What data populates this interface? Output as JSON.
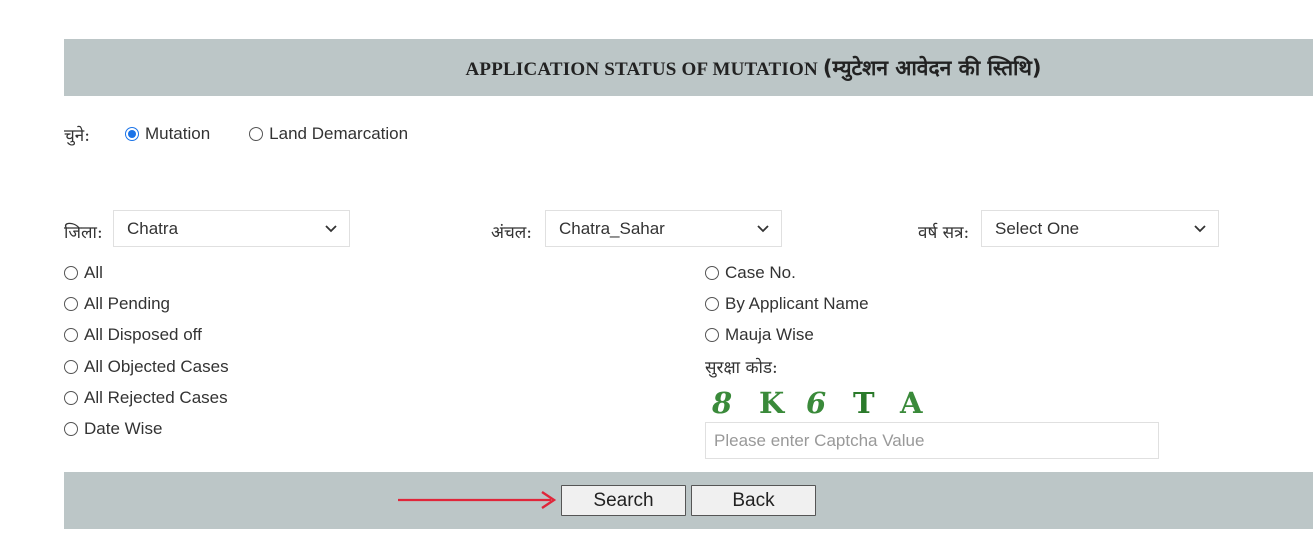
{
  "header": {
    "title_en": "APPLICATION STATUS OF MUTATION",
    "title_hi": "(म्युटेशन आवेदन की स्तिथि)"
  },
  "choose": {
    "label": "चुने:",
    "options": [
      {
        "label": "Mutation",
        "checked": true
      },
      {
        "label": "Land Demarcation",
        "checked": false
      }
    ]
  },
  "filters": {
    "district": {
      "label": "जिला:",
      "value": "Chatra"
    },
    "circle": {
      "label": "अंचल:",
      "value": "Chatra_Sahar"
    },
    "session": {
      "label": "वर्ष सत्र:",
      "value": "Select One"
    }
  },
  "left_options": [
    {
      "label": "All"
    },
    {
      "label": "All Pending"
    },
    {
      "label": "All Disposed off"
    },
    {
      "label": "All Objected Cases"
    },
    {
      "label": "All Rejected Cases"
    },
    {
      "label": "Date Wise"
    }
  ],
  "right_options": [
    {
      "label": "Case No."
    },
    {
      "label": "By Applicant Name"
    },
    {
      "label": "Mauja Wise"
    }
  ],
  "captcha": {
    "label": "सुरक्षा कोड:",
    "chars": [
      "8",
      "K",
      "6",
      "T",
      "A"
    ],
    "placeholder": "Please enter Captcha Value",
    "color": "#3a8a3a"
  },
  "buttons": {
    "search": "Search",
    "back": "Back"
  },
  "colors": {
    "band": "#bcc6c7",
    "radio_accent": "#1a73e8",
    "arrow": "#e0263a"
  },
  "icons": {
    "select_arrow": "chevron-down-icon",
    "pointer": "red-arrow-icon"
  }
}
